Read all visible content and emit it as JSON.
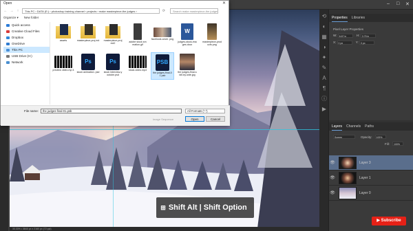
{
  "dialog": {
    "title": "Open",
    "breadcrumb": "This PC  ›  DATA (E:)  ›  photoshop training channel  ›  projects  ›  make masterpiece-the judges  ›",
    "search_placeholder": "Search make masterpiece-the judges",
    "organize_label": "Organize ▾",
    "new_folder_label": "New folder",
    "nav_items": [
      {
        "label": "Quick access",
        "icon": "star-icon",
        "color": "#2b7bd8"
      },
      {
        "label": "Creative Cloud Files",
        "icon": "cloud-icon",
        "color": "#d83b3b"
      },
      {
        "label": "Dropbox",
        "icon": "dropbox-icon",
        "color": "#2f88d8"
      },
      {
        "label": "OneDrive",
        "icon": "onedrive-icon",
        "color": "#2f7bd0"
      },
      {
        "label": "This PC",
        "icon": "computer-icon",
        "color": "#4a90d9"
      },
      {
        "label": "USB Drive (H:)",
        "icon": "usb-icon",
        "color": "#777777"
      },
      {
        "label": "Network",
        "icon": "network-icon",
        "color": "#4a8fd0"
      }
    ],
    "files": [
      {
        "label": "assets",
        "kind": "folder"
      },
      {
        "label": "masterpiece-proj ect",
        "kind": "folder"
      },
      {
        "label": "masterpiece-proj ect2",
        "kind": "folder"
      },
      {
        "label": "adobe stock sm mation.gif",
        "kind": "gif"
      },
      {
        "label": "facebook-cover. png",
        "kind": "image"
      },
      {
        "label": "judges-stock-ima ges.docx",
        "kind": "word"
      },
      {
        "label": "masterpiece-prod ucts.png",
        "kind": "image2"
      },
      {
        "label": "preview video.mp 4",
        "kind": "video"
      },
      {
        "label": "stock animation. psd",
        "kind": "psd"
      },
      {
        "label": "stock interview-y outube.psd",
        "kind": "psd"
      },
      {
        "label": "stock-video.mp4",
        "kind": "video"
      },
      {
        "label": "the judges-final-0 1.psb",
        "kind": "psb"
      },
      {
        "label": "the judges-final-s ide-by-side.jpg",
        "kind": "image3"
      }
    ],
    "file_name_label": "File name:",
    "file_name_value": "the judges-final-01.psb",
    "file_type_value": "All Formats (*.*)",
    "image_sequence_label": "Image Sequence",
    "open_label": "Open",
    "cancel_label": "Cancel"
  },
  "properties_panel": {
    "tabs": [
      "Properties",
      "Libraries"
    ],
    "title": "Pixel Layer Properties",
    "w_label": "W:",
    "w_value": "6.67 in",
    "h_label": "H:",
    "h_value": "3.75 in",
    "x_label": "X:",
    "x_value": "0 px",
    "y_label": "Y:",
    "y_value": "0 px"
  },
  "layers_panel": {
    "tabs": [
      "Layers",
      "Channels",
      "Paths"
    ],
    "blend_mode": "Screen",
    "opacity_label": "Opacity:",
    "opacity_value": "100%",
    "fill_label": "Fill:",
    "fill_value": "100%",
    "layers": [
      {
        "name": "Layer 3",
        "selected": true
      },
      {
        "name": "Layer 1",
        "selected": false
      },
      {
        "name": "Layer 0",
        "selected": false
      }
    ]
  },
  "overlay": {
    "windows_key": "⊞",
    "text": "Shift Alt | Shift Option",
    "apple_key": ""
  },
  "badge": {
    "label": "▶ Subscribe"
  },
  "status": {
    "text": "33.33% • 3840 px x 2160 px (72 ppi)"
  }
}
